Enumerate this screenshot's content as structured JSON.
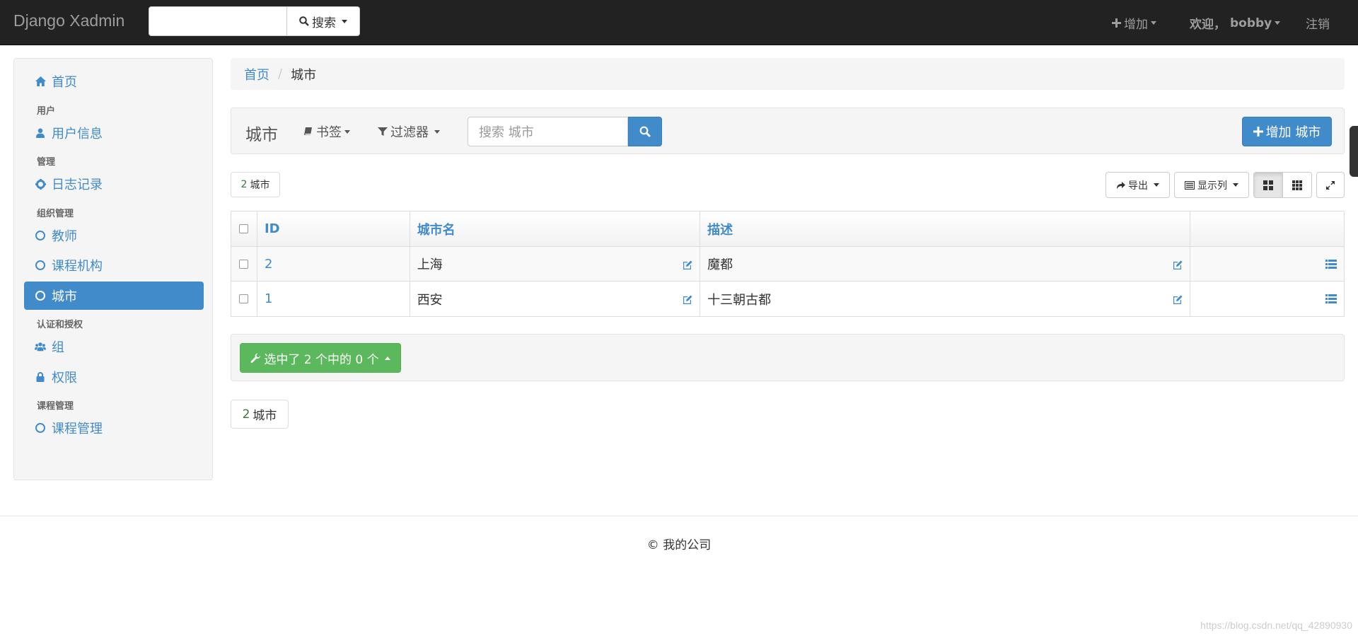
{
  "navbar": {
    "brand": "Django Xadmin",
    "search_label": "搜索",
    "add_label": "增加",
    "welcome_label": "欢迎，",
    "username": "bobby",
    "logout_label": "注销"
  },
  "sidebar": {
    "items": [
      {
        "type": "item",
        "label": "首页",
        "icon": "home-icon"
      },
      {
        "type": "header",
        "label": "用户"
      },
      {
        "type": "item",
        "label": "用户信息",
        "icon": "user-icon"
      },
      {
        "type": "header",
        "label": "管理"
      },
      {
        "type": "item",
        "label": "日志记录",
        "icon": "gear-icon"
      },
      {
        "type": "header",
        "label": "组织管理"
      },
      {
        "type": "item",
        "label": "教师",
        "icon": "circle-icon"
      },
      {
        "type": "item",
        "label": "课程机构",
        "icon": "circle-icon"
      },
      {
        "type": "item",
        "label": "城市",
        "icon": "circle-icon",
        "active": true
      },
      {
        "type": "header",
        "label": "认证和授权"
      },
      {
        "type": "item",
        "label": "组",
        "icon": "users-icon"
      },
      {
        "type": "item",
        "label": "权限",
        "icon": "lock-icon"
      },
      {
        "type": "header",
        "label": "课程管理"
      },
      {
        "type": "item",
        "label": "课程管理",
        "icon": "circle-icon"
      }
    ]
  },
  "breadcrumb": {
    "home": "首页",
    "current": "城市"
  },
  "toolbar": {
    "title": "城市",
    "bookmarks_label": "书签",
    "filters_label": "过滤器",
    "search_placeholder": "搜索 城市",
    "add_button_label": "增加 城市"
  },
  "results": {
    "count": "2",
    "count_unit": "城市",
    "export_label": "导出",
    "columns_label": "显示列"
  },
  "table": {
    "headers": [
      "ID",
      "城市名",
      "描述"
    ],
    "rows": [
      {
        "id": "2",
        "name": "上海",
        "desc": "魔都"
      },
      {
        "id": "1",
        "name": "西安",
        "desc": "十三朝古都"
      }
    ]
  },
  "actions": {
    "selected_label": "选中了 2 个中的 0 个"
  },
  "footer": {
    "copyright": "© 我的公司"
  },
  "watermark": "https://blog.csdn.net/qq_42890930",
  "colors": {
    "primary": "#428bca",
    "success": "#5cb85c",
    "navbar": "#222222"
  }
}
